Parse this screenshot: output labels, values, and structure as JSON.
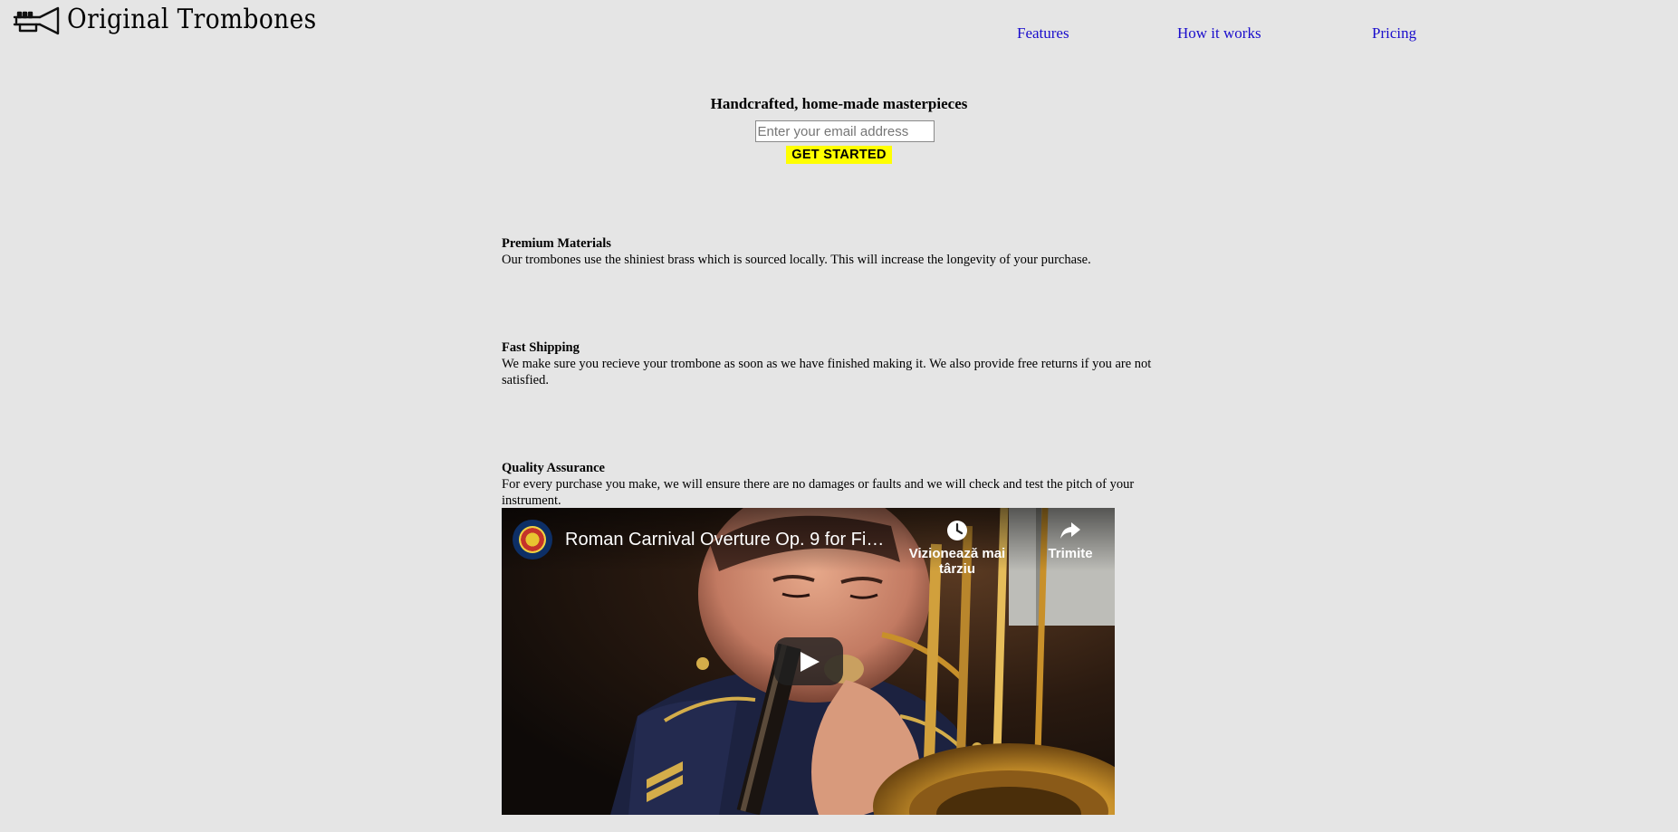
{
  "header": {
    "logo_text": "Original Trombones",
    "nav": {
      "features": "Features",
      "how_it_works": "How it works",
      "pricing": "Pricing"
    }
  },
  "hero": {
    "title": "Handcrafted, home-made masterpieces",
    "email_placeholder": "Enter your email address",
    "button_label": "GET STARTED"
  },
  "features": [
    {
      "title": "Premium Materials",
      "text": "Our trombones use the shiniest brass which is sourced locally. This will increase the longevity of your purchase."
    },
    {
      "title": "Fast Shipping",
      "text": "We make sure you recieve your trombone as soon as we have finished making it. We also provide free returns if you are not satisfied."
    },
    {
      "title": "Quality Assurance",
      "text": "For every purchase you make, we will ensure there are no damages or faults and we will check and test the pitch of your instrument."
    }
  ],
  "video": {
    "title": "Roman Carnival Overture Op. 9 for Fi…",
    "watch_later_label": "Vizionează mai târziu",
    "share_label": "Trimite",
    "play_icon": "play-icon",
    "watch_later_icon": "clock-icon",
    "share_icon": "share-arrow-icon"
  },
  "colors": {
    "background": "#e5e5e5",
    "link": "#1a0dcc",
    "button": "#ffff00"
  }
}
